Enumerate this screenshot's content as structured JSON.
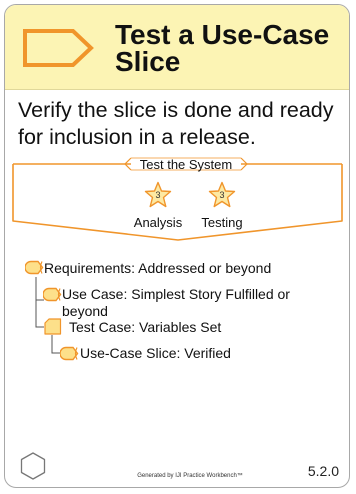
{
  "card": {
    "title": "Test a Use-Case\nSlice",
    "description": "Verify the slice is done and ready for inclusion in a release.",
    "header_color": "#fcf4b4",
    "accent_color": "#f0952b",
    "icon": "activity-chevron-icon"
  },
  "activity": {
    "label": "Test the System",
    "competencies": [
      {
        "name": "Analysis",
        "level": "3",
        "icon": "star-icon"
      },
      {
        "name": "Testing",
        "level": "3",
        "icon": "star-icon"
      }
    ]
  },
  "states": [
    {
      "label": "Requirements: Addressed or beyond",
      "icon": "alpha-icon"
    },
    {
      "label": "Use Case: Simplest Story Fulfilled or\nbeyond",
      "icon": "alpha-icon"
    },
    {
      "label": "Test Case: Variables Set",
      "icon": "work-product-icon"
    },
    {
      "label": "Use-Case Slice: Verified",
      "icon": "alpha-icon"
    }
  ],
  "footer": {
    "generated": "Generated by IJI Practice Workbench™",
    "version": "5.2.0",
    "icon": "hexagon-icon"
  }
}
